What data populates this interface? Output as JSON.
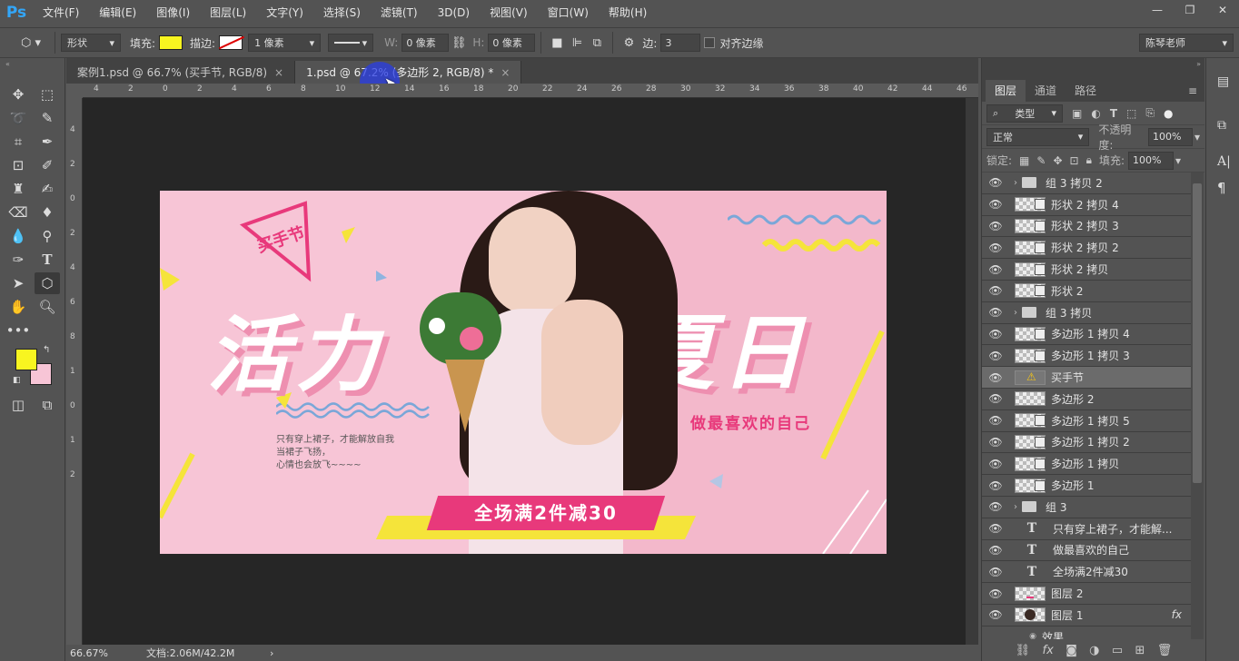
{
  "app": {
    "logo": "Ps"
  },
  "menu": [
    "文件(F)",
    "编辑(E)",
    "图像(I)",
    "图层(L)",
    "文字(Y)",
    "选择(S)",
    "滤镜(T)",
    "3D(D)",
    "视图(V)",
    "窗口(W)",
    "帮助(H)"
  ],
  "window_controls": {
    "minimize": "—",
    "restore": "❐",
    "close": "✕"
  },
  "options": {
    "shape_mode": "形状",
    "fill_label": "填充:",
    "fill_color": "#f8f520",
    "stroke_label": "描边:",
    "stroke_width": "1 像素",
    "w_label": "W:",
    "w_value": "0 像素",
    "h_label": "H:",
    "h_value": "0 像素",
    "sides_label": "边:",
    "sides_value": "3",
    "align_edges": "对齐边缘",
    "workspace": "陈琴老师"
  },
  "tabs": [
    {
      "label": "案例1.psd @ 66.7% (买手节, RGB/8)",
      "close": "×"
    },
    {
      "label": "1.psd @ 67.2% (多边形 2, RGB/8) *",
      "close": "×"
    }
  ],
  "ruler_top": [
    "4",
    "2",
    "0",
    "2",
    "4",
    "6",
    "8",
    "10",
    "12",
    "14",
    "16",
    "18",
    "20",
    "22",
    "24",
    "26",
    "28",
    "30",
    "32",
    "34",
    "36",
    "38",
    "40",
    "42",
    "44",
    "46"
  ],
  "ruler_left": [
    "4",
    "2",
    "0",
    "2",
    "4",
    "6",
    "8",
    "1",
    "0",
    "1",
    "2"
  ],
  "colors": {
    "foreground": "#f8f520",
    "background": "#f7c5d6"
  },
  "artwork": {
    "tag": "买手节",
    "headline_left": "活力",
    "headline_right": "夏日",
    "slogan": "做最喜欢的自己",
    "copy": [
      "只有穿上裙子，才能解放自我",
      "当裙子飞扬，",
      "心情也会放飞~~~~"
    ],
    "promo": "全场满2件减30"
  },
  "status": {
    "zoom": "66.67%",
    "doc": "文档:2.06M/42.2M",
    "arrow": "›"
  },
  "layers_panel": {
    "tabs": [
      "图层",
      "通道",
      "路径"
    ],
    "filter": "类型",
    "blend_mode": "正常",
    "opacity_label": "不透明度:",
    "opacity": "100%",
    "lock_label": "锁定:",
    "fill_label": "填充:",
    "fill": "100%",
    "layers": [
      {
        "type": "group",
        "name": "组 3 拷贝 2"
      },
      {
        "type": "shape",
        "name": "形状 2 拷贝 4"
      },
      {
        "type": "shape",
        "name": "形状 2 拷贝 3"
      },
      {
        "type": "shape",
        "name": "形状 2 拷贝 2"
      },
      {
        "type": "shape",
        "name": "形状 2 拷贝"
      },
      {
        "type": "shape",
        "name": "形状 2"
      },
      {
        "type": "group",
        "name": "组 3 拷贝"
      },
      {
        "type": "shape",
        "name": "多边形 1 拷贝 4"
      },
      {
        "type": "shape",
        "name": "多边形 1 拷贝 3"
      },
      {
        "type": "warn",
        "name": "买手节"
      },
      {
        "type": "plain",
        "name": "多边形 2"
      },
      {
        "type": "shape",
        "name": "多边形 1 拷贝 5"
      },
      {
        "type": "shape",
        "name": "多边形 1 拷贝 2"
      },
      {
        "type": "shape",
        "name": "多边形 1 拷贝"
      },
      {
        "type": "shape",
        "name": "多边形 1"
      },
      {
        "type": "group",
        "name": "组 3"
      },
      {
        "type": "text",
        "name": "只有穿上裙子，才能解..."
      },
      {
        "type": "text",
        "name": "做最喜欢的自己"
      },
      {
        "type": "text",
        "name": "全场满2件减30"
      },
      {
        "type": "pixel",
        "name": "图层 2"
      },
      {
        "type": "photo",
        "name": "图层 1",
        "fx": "fx"
      },
      {
        "type": "effect",
        "name": "效果"
      }
    ]
  }
}
